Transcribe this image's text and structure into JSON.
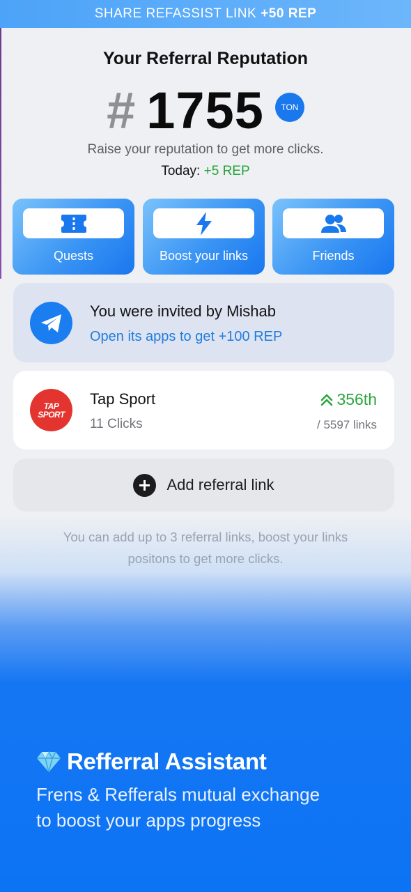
{
  "banner": {
    "text": "SHARE REFASSIST LINK",
    "reward": "+50 REP"
  },
  "header": {
    "title": "Your Referral Reputation",
    "rank_hash": "#",
    "rank_number": "1755",
    "currency_badge": "TON",
    "subtitle": "Raise your reputation to get more clicks.",
    "today_label": "Today:",
    "today_value": "+5 REP"
  },
  "actions": [
    {
      "label": "Quests",
      "icon": "ticket-icon"
    },
    {
      "label": "Boost your links",
      "icon": "lightning-icon"
    },
    {
      "label": "Friends",
      "icon": "friends-icon"
    }
  ],
  "invite": {
    "title": "You were invited by Mishab",
    "subtitle_prefix": "Open its apps to get",
    "subtitle_reward": "+100 REP",
    "icon": "telegram-icon"
  },
  "referral_link": {
    "logo_text_line1": "TAP",
    "logo_text_line2": "SPORT",
    "name": "Tap Sport",
    "clicks": "11 Clicks",
    "rank": "356th",
    "total": "/ 5597 links"
  },
  "add_button": {
    "label": "Add referral link",
    "icon": "plus-icon"
  },
  "hint": "You can add up to 3 referral links, boost your links positons to get more clicks.",
  "promo": {
    "title": "Refferral Assistant",
    "subtitle_line1": "Frens & Refferals mutual exchange",
    "subtitle_line2": "to boost your apps progress",
    "icon": "diamond-icon"
  },
  "colors": {
    "accent": "#1a78ee",
    "green": "#24a33a",
    "link_blue": "#1f7ddd",
    "promo_blue": "#0c74f4"
  }
}
